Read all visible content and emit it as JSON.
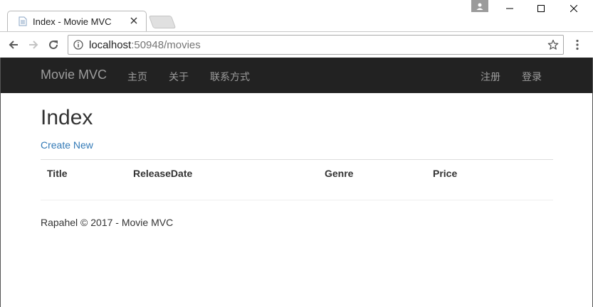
{
  "browser": {
    "tab_title": "Index - Movie MVC",
    "url_host": "localhost",
    "url_rest": ":50948/movies"
  },
  "navbar": {
    "brand": "Movie MVC",
    "links": [
      "主页",
      "关于",
      "联系方式"
    ],
    "right_links": [
      "注册",
      "登录"
    ]
  },
  "page": {
    "title": "Index",
    "create_link": "Create New",
    "table_headers": [
      "Title",
      "ReleaseDate",
      "Genre",
      "Price"
    ],
    "footer": "Rapahel © 2017 - Movie MVC"
  },
  "colors": {
    "navbar_bg": "#222222",
    "navbar_text": "#9d9d9d",
    "link": "#337ab7"
  },
  "icons": [
    "page-icon",
    "close-icon",
    "user-icon",
    "minimize-icon",
    "maximize-icon",
    "close-window-icon",
    "back-arrow-icon",
    "forward-arrow-icon",
    "reload-icon",
    "info-icon",
    "star-icon",
    "menu-dots-icon"
  ]
}
